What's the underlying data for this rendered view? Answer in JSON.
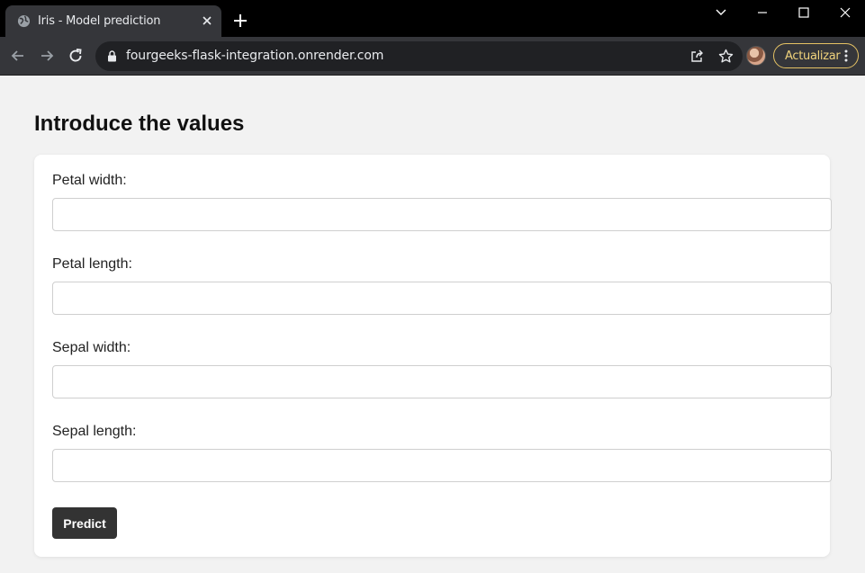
{
  "browser": {
    "tab": {
      "title": "Iris - Model prediction",
      "favicon": "globe-icon"
    },
    "url": "fourgeeks-flask-integration.onrender.com",
    "update_button": "Actualizar",
    "icons": [
      "back-arrow-icon",
      "forward-arrow-icon",
      "reload-icon",
      "lock-icon",
      "share-icon",
      "star-icon",
      "kebab-menu-icon",
      "new-tab-plus-icon",
      "chevron-down-icon",
      "minimize-icon",
      "maximize-icon",
      "close-icon"
    ]
  },
  "page": {
    "title": "Introduce the values",
    "fields": [
      {
        "label": "Petal width:",
        "value": "",
        "placeholder": ""
      },
      {
        "label": "Petal length:",
        "value": "",
        "placeholder": ""
      },
      {
        "label": "Sepal width:",
        "value": "",
        "placeholder": ""
      },
      {
        "label": "Sepal length:",
        "value": "",
        "placeholder": ""
      }
    ],
    "submit_label": "Predict"
  },
  "colors": {
    "tabbar": "#000000",
    "toolbar": "#35363a",
    "omnibox": "#202124",
    "update_accent": "#e5c264",
    "page_bg": "#f2f2f2",
    "button": "#333333"
  }
}
